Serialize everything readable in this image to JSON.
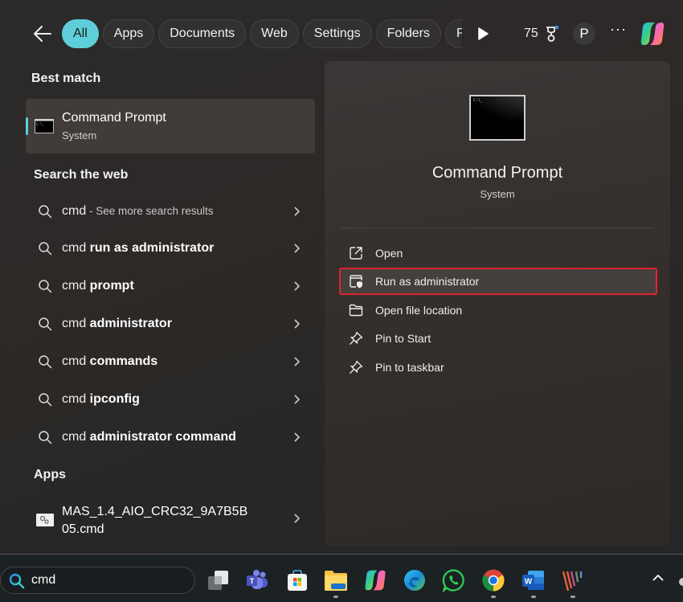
{
  "topbar": {
    "back_icon": "arrow-left-icon",
    "chips": [
      {
        "label": "All",
        "active": true
      },
      {
        "label": "Apps",
        "active": false
      },
      {
        "label": "Documents",
        "active": false
      },
      {
        "label": "Web",
        "active": false
      },
      {
        "label": "Settings",
        "active": false
      },
      {
        "label": "Folders",
        "active": false
      },
      {
        "label": "Pho",
        "active": false
      }
    ],
    "play_icon": "play-icon",
    "rewards_points": "75",
    "rewards_icon": "trophy-icon",
    "profile_initial": "P",
    "more_label": "···",
    "copilot_icon": "copilot-icon"
  },
  "left": {
    "best_match_heading": "Best match",
    "best_match": {
      "name": "Command Prompt",
      "type": "System",
      "icon": "command-prompt-icon"
    },
    "web_heading": "Search the web",
    "web_results": [
      {
        "prefix": "cmd",
        "bold": "",
        "suffix": " - See more search results"
      },
      {
        "prefix": "cmd ",
        "bold": "run as administrator",
        "suffix": ""
      },
      {
        "prefix": "cmd ",
        "bold": "prompt",
        "suffix": ""
      },
      {
        "prefix": "cmd ",
        "bold": "administrator",
        "suffix": ""
      },
      {
        "prefix": "cmd ",
        "bold": "commands",
        "suffix": ""
      },
      {
        "prefix": "cmd ",
        "bold": "ipconfig",
        "suffix": ""
      },
      {
        "prefix": "cmd ",
        "bold": "administrator command",
        "suffix": ""
      }
    ],
    "apps_heading": "Apps",
    "apps": [
      {
        "name": "MAS_1.4_AIO_CRC32_9A7B5B05.cmd",
        "icon": "batch-file-icon"
      }
    ]
  },
  "preview": {
    "title": "Command Prompt",
    "subtitle": "System",
    "actions": [
      {
        "label": "Open",
        "icon": "open-external-icon",
        "highlight": false
      },
      {
        "label": "Run as administrator",
        "icon": "shield-admin-icon",
        "highlight": true
      },
      {
        "label": "Open file location",
        "icon": "folder-icon",
        "highlight": false
      },
      {
        "label": "Pin to Start",
        "icon": "pin-icon",
        "highlight": false
      },
      {
        "label": "Pin to taskbar",
        "icon": "pin-icon",
        "highlight": false
      }
    ],
    "highlight_color": "#e0242c"
  },
  "taskbar": {
    "search_value": "cmd",
    "search_icon": "search-icon",
    "apps": [
      {
        "name": "task-view",
        "running": false
      },
      {
        "name": "teams",
        "running": false
      },
      {
        "name": "microsoft-store",
        "running": false
      },
      {
        "name": "file-explorer",
        "running": true
      },
      {
        "name": "copilot",
        "running": false
      },
      {
        "name": "edge",
        "running": false
      },
      {
        "name": "whatsapp",
        "running": false
      },
      {
        "name": "chrome",
        "running": true
      },
      {
        "name": "word",
        "running": true
      },
      {
        "name": "app-stripes",
        "running": true
      }
    ],
    "tray_icon": "chevron-up-icon"
  },
  "colors": {
    "accent": "#5ecfd9",
    "highlight_border": "#e0242c"
  }
}
